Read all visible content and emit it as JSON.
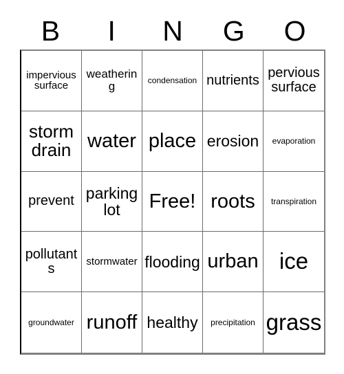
{
  "card": {
    "title_letters": [
      "B",
      "I",
      "N",
      "G",
      "O"
    ],
    "free_space_label": "Free!",
    "grid_size": "5x5",
    "colors": {
      "background": "#ffffff",
      "text": "#000000",
      "grid_line": "#6b6b6b",
      "outer_border": "#808080"
    },
    "rows": [
      [
        {
          "text": "impervious surface",
          "size": "sm"
        },
        {
          "text": "weathering",
          "size": "md"
        },
        {
          "text": "condensation",
          "size": "xs"
        },
        {
          "text": "nutrients",
          "size": "lg"
        },
        {
          "text": "pervious surface",
          "size": "lg"
        }
      ],
      [
        {
          "text": "storm drain",
          "size": "2xl"
        },
        {
          "text": "water",
          "size": "3xl"
        },
        {
          "text": "place",
          "size": "3xl"
        },
        {
          "text": "erosion",
          "size": "xl"
        },
        {
          "text": "evaporation",
          "size": "xs"
        }
      ],
      [
        {
          "text": "prevent",
          "size": "lg"
        },
        {
          "text": "parking lot",
          "size": "xl"
        },
        {
          "text": "Free!",
          "size": "3xl"
        },
        {
          "text": "roots",
          "size": "3xl"
        },
        {
          "text": "transpiration",
          "size": "xs"
        }
      ],
      [
        {
          "text": "pollutants",
          "size": "lg"
        },
        {
          "text": "stormwater",
          "size": "sm"
        },
        {
          "text": "flooding",
          "size": "xl"
        },
        {
          "text": "urban",
          "size": "3xl"
        },
        {
          "text": "ice",
          "size": "4xl"
        }
      ],
      [
        {
          "text": "groundwater",
          "size": "xs"
        },
        {
          "text": "runoff",
          "size": "3xl"
        },
        {
          "text": "healthy",
          "size": "xl"
        },
        {
          "text": "precipitation",
          "size": "xs"
        },
        {
          "text": "grass",
          "size": "4xl"
        }
      ]
    ]
  }
}
